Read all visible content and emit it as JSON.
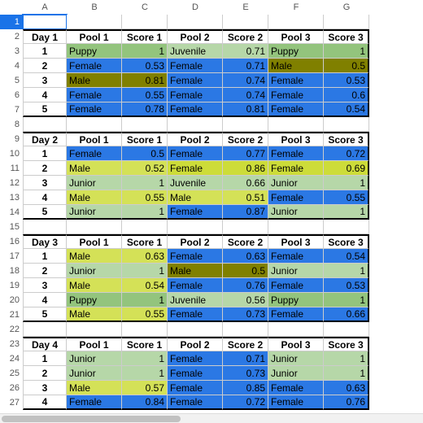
{
  "columns": [
    "A",
    "B",
    "C",
    "D",
    "E",
    "F",
    "G"
  ],
  "rows": [
    1,
    2,
    3,
    4,
    5,
    6,
    7,
    8,
    9,
    10,
    11,
    12,
    13,
    14,
    15,
    16,
    17,
    18,
    19,
    20,
    21,
    22,
    23,
    24,
    25,
    26,
    27
  ],
  "selectedRow": 1,
  "headers": [
    "",
    "Pool 1",
    "Score 1",
    "Pool 2",
    "Score 2",
    "Pool 3",
    "Score 3"
  ],
  "days": [
    {
      "label": "Day 1",
      "rows": [
        {
          "n": "1",
          "p1": "Puppy",
          "s1": "1",
          "p2": "Juvenile",
          "s2": "0.71",
          "p3": "Puppy",
          "s3": "1"
        },
        {
          "n": "2",
          "p1": "Female",
          "s1": "0.53",
          "p2": "Female",
          "s2": "0.71",
          "p3": "Male",
          "s3": "0.5"
        },
        {
          "n": "3",
          "p1": "Male",
          "s1": "0.81",
          "p2": "Female",
          "s2": "0.74",
          "p3": "Female",
          "s3": "0.53"
        },
        {
          "n": "4",
          "p1": "Female",
          "s1": "0.55",
          "p2": "Female",
          "s2": "0.74",
          "p3": "Female",
          "s3": "0.6"
        },
        {
          "n": "5",
          "p1": "Female",
          "s1": "0.78",
          "p2": "Female",
          "s2": "0.81",
          "p3": "Female",
          "s3": "0.54"
        }
      ]
    },
    {
      "label": "Day 2",
      "rows": [
        {
          "n": "1",
          "p1": "Female",
          "s1": "0.5",
          "p2": "Female",
          "s2": "0.77",
          "p3": "Female",
          "s3": "0.72"
        },
        {
          "n": "2",
          "p1": "Male",
          "s1": "0.52",
          "p2": "Female",
          "s2": "0.86",
          "p3": "Female",
          "s3": "0.69"
        },
        {
          "n": "3",
          "p1": "Junior",
          "s1": "1",
          "p2": "Juvenile",
          "s2": "0.66",
          "p3": "Junior",
          "s3": "1"
        },
        {
          "n": "4",
          "p1": "Male",
          "s1": "0.55",
          "p2": "Male",
          "s2": "0.51",
          "p3": "Female",
          "s3": "0.55"
        },
        {
          "n": "5",
          "p1": "Junior",
          "s1": "1",
          "p2": "Female",
          "s2": "0.87",
          "p3": "Junior",
          "s3": "1"
        }
      ]
    },
    {
      "label": "Day 3",
      "rows": [
        {
          "n": "1",
          "p1": "Male",
          "s1": "0.63",
          "p2": "Female",
          "s2": "0.63",
          "p3": "Female",
          "s3": "0.54"
        },
        {
          "n": "2",
          "p1": "Junior",
          "s1": "1",
          "p2": "Male",
          "s2": "0.5",
          "p3": "Junior",
          "s3": "1"
        },
        {
          "n": "3",
          "p1": "Male",
          "s1": "0.54",
          "p2": "Female",
          "s2": "0.76",
          "p3": "Female",
          "s3": "0.53"
        },
        {
          "n": "4",
          "p1": "Puppy",
          "s1": "1",
          "p2": "Juvenile",
          "s2": "0.56",
          "p3": "Puppy",
          "s3": "1"
        },
        {
          "n": "5",
          "p1": "Male",
          "s1": "0.55",
          "p2": "Female",
          "s2": "0.73",
          "p3": "Female",
          "s3": "0.66"
        }
      ]
    },
    {
      "label": "Day 4",
      "rows": [
        {
          "n": "1",
          "p1": "Junior",
          "s1": "1",
          "p2": "Female",
          "s2": "0.71",
          "p3": "Junior",
          "s3": "1"
        },
        {
          "n": "2",
          "p1": "Junior",
          "s1": "1",
          "p2": "Female",
          "s2": "0.73",
          "p3": "Junior",
          "s3": "1"
        },
        {
          "n": "3",
          "p1": "Male",
          "s1": "0.57",
          "p2": "Female",
          "s2": "0.85",
          "p3": "Female",
          "s3": "0.63"
        },
        {
          "n": "4",
          "p1": "Female",
          "s1": "0.84",
          "p2": "Female",
          "s2": "0.72",
          "p3": "Female",
          "s3": "0.76"
        }
      ]
    }
  ],
  "colorMap": {
    "Puppy": "c-puppy",
    "Female": "c-female",
    "Male": "c-male",
    "Junior": "c-junior",
    "Juvenile": "c-junior"
  },
  "maleYellowOverrides": [
    "Day 2-2",
    "Day 2-4",
    "Day 3-1",
    "Day 3-3",
    "Day 3-5",
    "Day 4-3"
  ],
  "femaleYellowOverrides": [
    "Day 2-2-p2",
    "Day 2-2-p3"
  ]
}
